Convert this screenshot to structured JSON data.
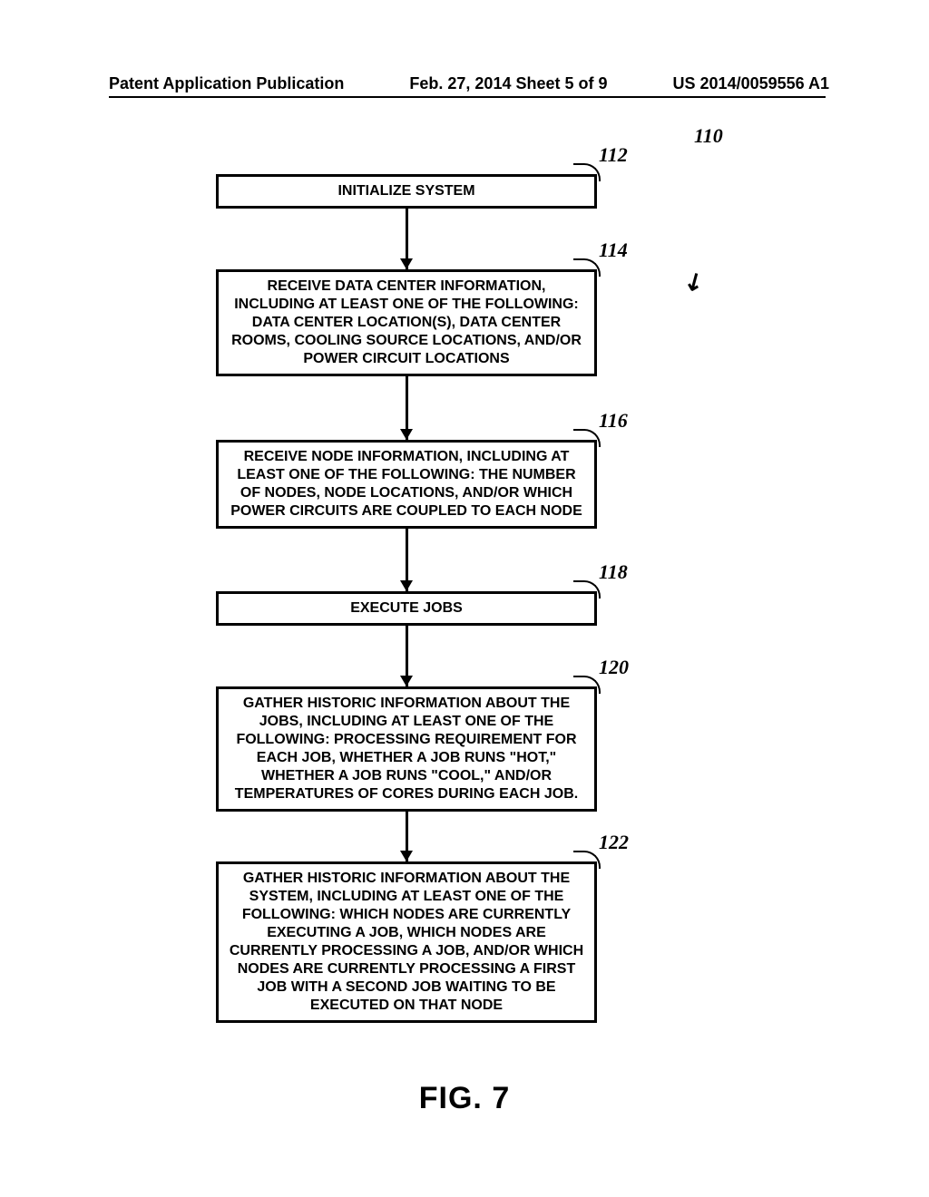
{
  "header": {
    "left": "Patent Application Publication",
    "center": "Feb. 27, 2014  Sheet 5 of 9",
    "right": "US 2014/0059556 A1"
  },
  "refs": {
    "r110": "110",
    "r112": "112",
    "r114": "114",
    "r116": "116",
    "r118": "118",
    "r120": "120",
    "r122": "122"
  },
  "boxes": {
    "b112": "INITIALIZE SYSTEM",
    "b114": "RECEIVE DATA CENTER INFORMATION, INCLUDING AT LEAST ONE OF THE FOLLOWING: DATA CENTER LOCATION(S), DATA CENTER ROOMS, COOLING SOURCE LOCATIONS, AND/OR POWER CIRCUIT LOCATIONS",
    "b116": "RECEIVE NODE INFORMATION, INCLUDING AT LEAST ONE OF THE FOLLOWING: THE NUMBER OF NODES, NODE LOCATIONS, AND/OR WHICH POWER CIRCUITS ARE COUPLED TO EACH NODE",
    "b118": "EXECUTE JOBS",
    "b120": "GATHER HISTORIC INFORMATION ABOUT THE JOBS, INCLUDING AT LEAST ONE OF THE FOLLOWING: PROCESSING REQUIREMENT FOR EACH JOB, WHETHER A JOB RUNS \"HOT,\" WHETHER A JOB RUNS \"COOL,\" AND/OR TEMPERATURES OF CORES DURING EACH JOB.",
    "b122": "GATHER HISTORIC INFORMATION ABOUT THE SYSTEM, INCLUDING AT LEAST ONE OF THE FOLLOWING: WHICH NODES ARE CURRENTLY EXECUTING A JOB, WHICH NODES ARE CURRENTLY PROCESSING A JOB, AND/OR WHICH NODES ARE CURRENTLY PROCESSING A FIRST JOB WITH A SECOND JOB WAITING TO BE EXECUTED ON THAT NODE"
  },
  "figure_caption": "FIG. 7",
  "chart_data": {
    "type": "flowchart",
    "title": "FIG. 7",
    "overall_ref": "110",
    "nodes": [
      {
        "ref": "112",
        "text": "INITIALIZE SYSTEM"
      },
      {
        "ref": "114",
        "text": "RECEIVE DATA CENTER INFORMATION, INCLUDING AT LEAST ONE OF THE FOLLOWING: DATA CENTER LOCATION(S), DATA CENTER ROOMS, COOLING SOURCE LOCATIONS, AND/OR POWER CIRCUIT LOCATIONS"
      },
      {
        "ref": "116",
        "text": "RECEIVE NODE INFORMATION, INCLUDING AT LEAST ONE OF THE FOLLOWING: THE NUMBER OF NODES, NODE LOCATIONS, AND/OR WHICH POWER CIRCUITS ARE COUPLED TO EACH NODE"
      },
      {
        "ref": "118",
        "text": "EXECUTE JOBS"
      },
      {
        "ref": "120",
        "text": "GATHER HISTORIC INFORMATION ABOUT THE JOBS, INCLUDING AT LEAST ONE OF THE FOLLOWING: PROCESSING REQUIREMENT FOR EACH JOB, WHETHER A JOB RUNS \"HOT,\" WHETHER A JOB RUNS \"COOL,\" AND/OR TEMPERATURES OF CORES DURING EACH JOB."
      },
      {
        "ref": "122",
        "text": "GATHER HISTORIC INFORMATION ABOUT THE SYSTEM, INCLUDING AT LEAST ONE OF THE FOLLOWING: WHICH NODES ARE CURRENTLY EXECUTING A JOB, WHICH NODES ARE CURRENTLY PROCESSING A JOB, AND/OR WHICH NODES ARE CURRENTLY PROCESSING A FIRST JOB WITH A SECOND JOB WAITING TO BE EXECUTED ON THAT NODE"
      }
    ],
    "edges": [
      {
        "from": "112",
        "to": "114"
      },
      {
        "from": "114",
        "to": "116"
      },
      {
        "from": "116",
        "to": "118"
      },
      {
        "from": "118",
        "to": "120"
      },
      {
        "from": "120",
        "to": "122"
      }
    ]
  }
}
